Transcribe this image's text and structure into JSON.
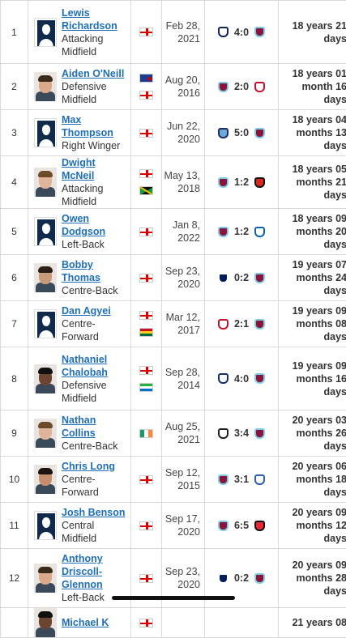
{
  "rows": [
    {
      "num": "1",
      "name": [
        "Lewis",
        "Richardson"
      ],
      "position": [
        "Attacking",
        "Midfield"
      ],
      "photo": "silhouette",
      "flags": [
        "england-flag"
      ],
      "date": [
        "Feb 28,",
        "2021"
      ],
      "home": "tottenham-crest",
      "score": "4:0",
      "away": "burnley-crest",
      "age": [
        "18 years 21",
        "days"
      ]
    },
    {
      "num": "2",
      "name": [
        "Aiden O'Neill"
      ],
      "position": [
        "Defensive",
        "Midfield"
      ],
      "photo": "photo",
      "flags": [
        "northern-ireland-flag",
        "england-flag"
      ],
      "date": [
        "Aug 20,",
        "2016"
      ],
      "home": "burnley-crest",
      "score": "2:0",
      "away": "liverpool-crest",
      "age": [
        "18 years 01",
        "month 16",
        "days"
      ]
    },
    {
      "num": "3",
      "name": [
        "Max Thompson"
      ],
      "position": [
        "Right Winger"
      ],
      "photo": "silhouette",
      "flags": [
        "england-flag"
      ],
      "date": [
        "Jun 22,",
        "2020"
      ],
      "home": "man-city-crest",
      "score": "5:0",
      "away": "burnley-crest",
      "age": [
        "18 years 04",
        "months 13",
        "days"
      ]
    },
    {
      "num": "4",
      "name": [
        "Dwight McNeil"
      ],
      "position": [
        "Attacking",
        "Midfield"
      ],
      "photo": "photo",
      "flags": [
        "england-flag",
        "jamaica-flag"
      ],
      "date": [
        "May 13,",
        "2018"
      ],
      "home": "burnley-crest",
      "score": "1:2",
      "away": "bournemouth-crest",
      "age": [
        "18 years 05",
        "months 21",
        "days"
      ]
    },
    {
      "num": "5",
      "name": [
        "Owen Dodgson"
      ],
      "position": [
        "Left-Back"
      ],
      "photo": "silhouette",
      "flags": [
        "england-flag"
      ],
      "date": [
        "Jan 8,",
        "2022"
      ],
      "home": "burnley-crest",
      "score": "1:2",
      "away": "huddersfield-crest",
      "age": [
        "18 years 09",
        "months 20",
        "days"
      ]
    },
    {
      "num": "6",
      "name": [
        "Bobby Thomas"
      ],
      "position": [
        "Centre-Back"
      ],
      "photo": "photo",
      "flags": [
        "england-flag"
      ],
      "date": [
        "Sep 23,",
        "2020"
      ],
      "home": "millwall-crest",
      "score": "0:2",
      "away": "burnley-crest",
      "age": [
        "19 years 07",
        "months 24",
        "days"
      ]
    },
    {
      "num": "7",
      "name": [
        "Dan Agyei"
      ],
      "position": [
        "Centre-Forward"
      ],
      "photo": "silhouette",
      "flags": [
        "england-flag",
        "ghana-flag"
      ],
      "date": [
        "Mar 12,",
        "2017"
      ],
      "home": "liverpool-crest",
      "score": "2:1",
      "away": "burnley-crest",
      "age": [
        "19 years 09",
        "months 08",
        "days"
      ]
    },
    {
      "num": "8",
      "name": [
        "Nathaniel",
        "Chalobah"
      ],
      "position": [
        "Defensive",
        "Midfield"
      ],
      "photo": "photo",
      "flags": [
        "england-flag",
        "sierra-leone-flag"
      ],
      "date": [
        "Sep 28,",
        "2014"
      ],
      "home": "west-brom-crest",
      "score": "4:0",
      "away": "burnley-crest",
      "age": [
        "19 years 09",
        "months 16",
        "days"
      ]
    },
    {
      "num": "9",
      "name": [
        "Nathan Collins"
      ],
      "position": [
        "Centre-Back"
      ],
      "photo": "photo",
      "flags": [
        "ireland-flag"
      ],
      "date": [
        "Aug 25,",
        "2021"
      ],
      "home": "newcastle-crest",
      "score": "3:4",
      "away": "burnley-crest",
      "age": [
        "20 years 03",
        "months 26",
        "days"
      ]
    },
    {
      "num": "10",
      "name": [
        "Chris Long"
      ],
      "position": [
        "Centre-Forward"
      ],
      "photo": "photo",
      "flags": [
        "england-flag"
      ],
      "date": [
        "Sep 12,",
        "2015"
      ],
      "home": "burnley-crest",
      "score": "3:1",
      "away": "sheffield-wednesday-crest",
      "age": [
        "20 years 06",
        "months 18",
        "days"
      ]
    },
    {
      "num": "11",
      "name": [
        "Josh Benson"
      ],
      "position": [
        "Central Midfield"
      ],
      "photo": "silhouette",
      "flags": [
        "england-flag"
      ],
      "date": [
        "Sep 17,",
        "2020"
      ],
      "home": "burnley-crest",
      "score": "6:5",
      "away": "sheffield-united-crest",
      "age": [
        "20 years 09",
        "months 12",
        "days"
      ]
    },
    {
      "num": "12",
      "name": [
        "Anthony",
        "Driscoll-",
        "Glennon"
      ],
      "position": [
        "Left-Back"
      ],
      "photo": "photo",
      "flags": [
        "england-flag"
      ],
      "date": [
        "Sep 23,",
        "2020"
      ],
      "home": "millwall-crest",
      "score": "0:2",
      "away": "burnley-crest",
      "age": [
        "20 years 09",
        "months 28",
        "days"
      ]
    },
    {
      "num": "",
      "name": [
        "Michael K"
      ],
      "position": [],
      "photo": "photo",
      "flags": [
        "england-flag"
      ],
      "date": [],
      "home": "",
      "score": "",
      "away": "",
      "age": [
        "21 years 08"
      ]
    }
  ],
  "colors": {
    "burnley": "#8a1538",
    "burnley_accent": "#7ecbe8",
    "tottenham": "#132257",
    "liverpool": "#c8102e",
    "man_city": "#6cabdd",
    "bournemouth": "#da291c",
    "huddersfield": "#0e63ad",
    "millwall": "#001d5e",
    "west_brom": "#122f67",
    "newcastle": "#241f20",
    "sheff_wed": "#2b5fb1",
    "sheff_utd": "#ee2737",
    "link": "#1e6fb5"
  }
}
